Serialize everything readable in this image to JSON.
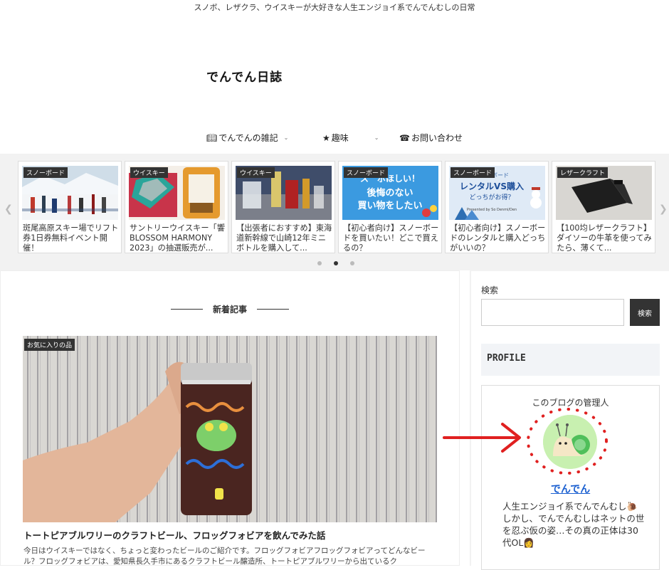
{
  "header": {
    "tagline": "スノボ、レザクラ、ウイスキーが大好きな人生エンジョイ系でんでんむしの日常",
    "logo": "でんでん日誌"
  },
  "nav": {
    "items": [
      {
        "icon": "book-icon",
        "label": "でんでんの雑記"
      },
      {
        "icon": "star-icon",
        "label": "趣味"
      },
      {
        "icon": "phone-icon",
        "label": "お問い合わせ"
      }
    ]
  },
  "carousel": {
    "cards": [
      {
        "category": "スノーボード",
        "title": "斑尾高原スキー場でリフト券1日券無料イベント開催！"
      },
      {
        "category": "ウイスキー",
        "title": "サントリーウイスキー「響 BLOSSOM HARMONY 2023」の抽選販売が..."
      },
      {
        "category": "ウイスキー",
        "title": "【出張者におすすめ】東海道新幹線で山崎12年ミニボトルを購入して..."
      },
      {
        "category": "スノーボード",
        "title": "【初心者向け】スノーボードを買いたい！どこで買えるの？"
      },
      {
        "category": "スノーボード",
        "title": "【初心者向け】スノーボードのレンタルと購入どっちがいいの？"
      },
      {
        "category": "レザークラフト",
        "title": "【100均レザークラフト】ダイソーの牛革を使ってみたら、薄くて..."
      }
    ],
    "thumb_texts": {
      "card4": [
        "ス　ボほしい！",
        "後悔のない",
        "買い物をしたい"
      ],
      "card5": [
        "スノーボード",
        "レンタルVS購入",
        "どっちがお得？",
        "Presented by So Denmi/Den"
      ]
    },
    "active_dot": 2
  },
  "main": {
    "section_title": "新着記事",
    "featured": {
      "category": "お気に入りの品",
      "title": "トートピアブルワリーのクラフトビール、フロッグフォビアを飲んでみた話",
      "excerpt": "今日はウイスキーではなく、ちょっと変わったビールのご紹介です。フロッグフォビアフロッグフォビアってどんなビール？フロッグフォビアは、愛知県長久手市にあるクラフトビール醸造所、トートピアブルワリーから出ているク"
    }
  },
  "sidebar": {
    "search_label": "検索",
    "search_value": "",
    "search_button": "検索",
    "profile_heading": "PROFILE",
    "profile_admin": "このブログの管理人",
    "profile_name": "でんでん",
    "profile_desc": "人生エンジョイ系でんでんむし🐌しかし、でんでんむしはネットの世を忍ぶ仮の姿…その真の正体は30代OL👩"
  },
  "colors": {
    "accent_link": "#1a5fd0",
    "annotation_red": "#e02020",
    "category_badge": "#333333"
  }
}
